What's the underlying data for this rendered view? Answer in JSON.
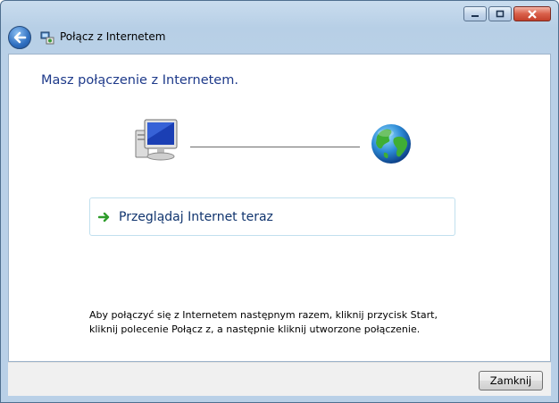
{
  "window": {
    "title": "Połącz z Internetem",
    "icons": {
      "back": "back-arrow-icon",
      "wizard": "network-connection-icon"
    },
    "controls": [
      "minimize-icon",
      "maximize-icon",
      "close-icon"
    ]
  },
  "main": {
    "heading": "Masz połączenie z Internetem.",
    "diagram": {
      "left_icon": "computer-icon",
      "right_icon": "globe-icon"
    },
    "browse_link": {
      "label": "Przeglądaj Internet teraz",
      "icon": "green-arrow-icon"
    },
    "info_line1": "Aby połączyć się z Internetem następnym razem, kliknij przycisk Start,",
    "info_line2": "kliknij polecenie Połącz z, a następnie kliknij utworzone połączenie."
  },
  "footer": {
    "close_label": "Zamknij"
  },
  "colors": {
    "heading": "#1e3a8a",
    "link_text": "#10346e",
    "link_border": "#c1e0ee",
    "titlebar": "#b9d0e7",
    "close_caption": "#c3402b"
  }
}
